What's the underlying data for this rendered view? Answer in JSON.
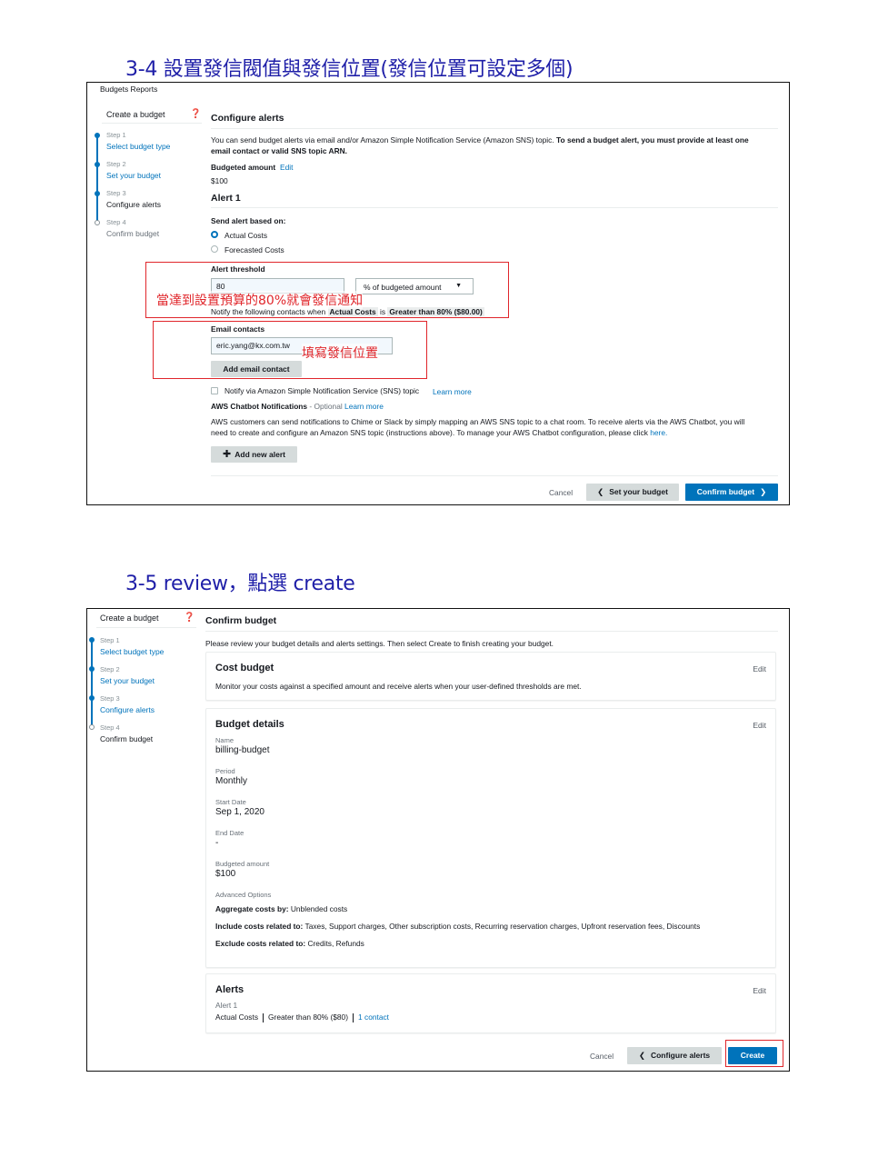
{
  "section1": {
    "heading": "3-4  設置發信閥值與發信位置(發信位置可設定多個)",
    "top_nav": "Budgets Reports",
    "sidebar_title": "Create a budget",
    "steps": [
      {
        "small": "Step 1",
        "label": "Select budget type"
      },
      {
        "small": "Step 2",
        "label": "Set your budget"
      },
      {
        "small": "Step 3",
        "label": "Configure alerts"
      },
      {
        "small": "Step 4",
        "label": "Confirm budget"
      }
    ],
    "page_title": "Configure alerts",
    "intro_text": "You can send budget alerts via email and/or Amazon Simple Notification Service (Amazon SNS) topic.",
    "intro_bold_1": "To send a budget alert, you must provide at least one",
    "intro_bold_2": "email contact or valid SNS topic ARN.",
    "budgeted_label": "Budgeted amount",
    "budgeted_edit": "Edit",
    "budgeted_value": "$100",
    "alert_title": "Alert 1",
    "send_based_label": "Send alert based on:",
    "radio_actual": "Actual Costs",
    "radio_forecast": "Forecasted Costs",
    "threshold_label": "Alert threshold",
    "threshold_value": "80",
    "threshold_select": "% of budgeted amount",
    "notify_text": "Notify the following contacts when",
    "notify_actual": "Actual Costs",
    "notify_is": "is",
    "notify_condition": "Greater than 80% ($80.00)",
    "annotation_threshold": "當達到設置預算的80%就會發信通知",
    "email_label": "Email contacts",
    "email_value": "eric.yang@kx.com.tw",
    "annotation_email": "填寫發信位置",
    "add_email_button": "Add email contact",
    "sns_checkbox": "Notify via Amazon Simple Notification Service (SNS) topic",
    "sns_learn_more": "Learn more",
    "chatbot_title": "AWS Chatbot Notifications",
    "chatbot_optional": "- Optional",
    "chatbot_learn_more": "Learn more",
    "chatbot_text_1": "AWS customers can send notifications to Chime or Slack by simply mapping an AWS SNS topic to a chat room. To receive alerts via the AWS Chatbot, you will",
    "chatbot_text_2": "need to create and configure an Amazon SNS topic (instructions above). To manage your AWS Chatbot configuration, please click",
    "chatbot_here": "here.",
    "add_alert_button": "Add new alert",
    "cancel": "Cancel",
    "back_button": "Set your budget",
    "next_button": "Confirm budget"
  },
  "section2": {
    "heading": "3-5 review，點選 create",
    "sidebar_title": "Create a budget",
    "steps": [
      {
        "small": "Step 1",
        "label": "Select budget type"
      },
      {
        "small": "Step 2",
        "label": "Set your budget"
      },
      {
        "small": "Step 3",
        "label": "Configure alerts"
      },
      {
        "small": "Step 4",
        "label": "Confirm budget"
      }
    ],
    "page_title": "Confirm budget",
    "intro_text": "Please review your budget details and alerts settings. Then select Create to finish creating your budget.",
    "cost_budget": {
      "title": "Cost budget",
      "edit": "Edit",
      "desc": "Monitor your costs against a specified amount and receive alerts when your user-defined thresholds are met."
    },
    "details": {
      "title": "Budget details",
      "edit": "Edit",
      "name_label": "Name",
      "name_value": "billing-budget",
      "period_label": "Period",
      "period_value": "Monthly",
      "start_label": "Start Date",
      "start_value": "Sep 1, 2020",
      "end_label": "End Date",
      "end_value": "-",
      "amount_label": "Budgeted amount",
      "amount_value": "$100",
      "advanced_label": "Advanced Options",
      "aggregate_label": "Aggregate costs by:",
      "aggregate_value": "Unblended costs",
      "include_label": "Include costs related to:",
      "include_value": "Taxes, Support charges, Other subscription costs, Recurring reservation charges, Upfront reservation fees, Discounts",
      "exclude_label": "Exclude costs related to:",
      "exclude_value": "Credits, Refunds"
    },
    "alerts": {
      "title": "Alerts",
      "edit": "Edit",
      "alert_name": "Alert 1",
      "basis": "Actual Costs",
      "condition": "Greater than 80% ($80)",
      "contacts": "1 contact"
    },
    "cancel": "Cancel",
    "back_button": "Configure alerts",
    "create_button": "Create"
  }
}
